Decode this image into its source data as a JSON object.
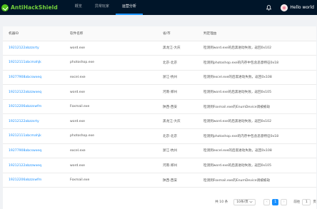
{
  "app": {
    "title": "AntiHackShield"
  },
  "nav": {
    "items": [
      {
        "label": "概览"
      },
      {
        "label": "异常玩家"
      },
      {
        "label": "运营分析"
      }
    ],
    "active_index": 2
  },
  "user": {
    "name": "Hello world"
  },
  "table": {
    "columns": [
      "机器ID",
      "软件名称",
      "省/市",
      "判定理由"
    ],
    "rows": [
      [
        "19212122abzzsrty",
        "word.exe",
        "黑龙江-大庆",
        "检测到word.exe的后黑进动失败，返回0x102"
      ],
      [
        "19212111abcmahjk",
        "photoshop.exe",
        "北京-北京",
        "检测到photoshop.exe的内存中包含恶意特征0x18"
      ],
      [
        "19277908abcswxeq",
        "excel.exe",
        "浙江-杭州",
        "检测到excel.exe的后黑进动失败，返回0x108"
      ],
      [
        "19212122abzzwxeq",
        "word.exe",
        "河南-郑州",
        "检测到word.exe的后黑进动失败，返回0x105"
      ],
      [
        "19212206abzzswfm",
        "Foxmail.exe",
        "陕西-西安",
        "检测到Foxmail.exe的EnumDevice调被被劫"
      ],
      [
        "19212122abzzsrty",
        "word.exe",
        "黑龙江-大庆",
        "检测到word.exe的后黑进动失败，返回0x102"
      ],
      [
        "19212111abcmahjk",
        "photoshop.exe",
        "北京-北京",
        "检测到photoshop.exe的内存中包含恶意特征0x18"
      ],
      [
        "19277908abcswxeq",
        "excel.exe",
        "浙江-杭州",
        "检测到excel.exe的后黑进动失败，返回0x108"
      ],
      [
        "19212122abzzwxeq",
        "word.exe",
        "河南-郑州",
        "检测到word.exe的后黑进动失败，返回0x105"
      ],
      [
        "19212206abzzswfm",
        "Foxmail.exe",
        "陕西-西安",
        "检测到Foxmail.exe的EnumDevice调被被劫"
      ]
    ]
  },
  "pagination": {
    "total": "共 10 条",
    "page_size": "10条/页",
    "prev": "‹",
    "current": "1",
    "next": "›",
    "jump_label": "前往",
    "jump_value": "1",
    "jump_suffix": "页"
  },
  "colors": {
    "accent": "#1890ff",
    "nav_bg": "#001529",
    "logo": "#73d13d"
  }
}
